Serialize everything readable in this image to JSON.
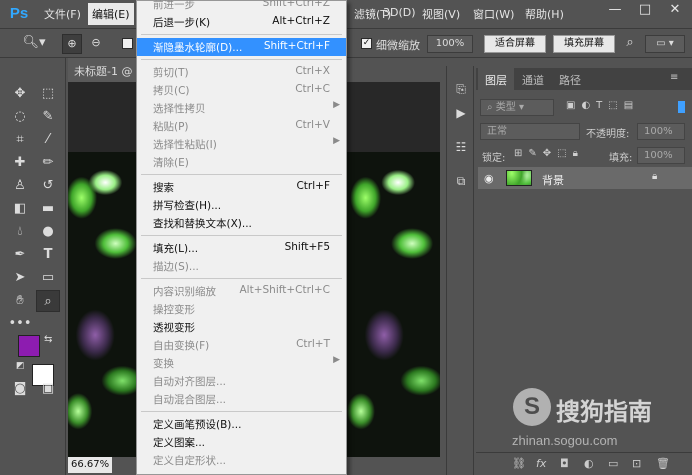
{
  "app": {
    "logo": "Ps",
    "menubar": [
      "文件(F)",
      "编辑(E)",
      "图像(I)",
      "图层(L)",
      "文字(Y)",
      "选择(S)",
      "滤镜(T)",
      "3D(D)",
      "视图(V)",
      "窗口(W)",
      "帮助(H)"
    ],
    "active_menu": "编辑(E)",
    "window_buttons": [
      "—",
      "□",
      "✕"
    ]
  },
  "options_bar": {
    "zoom_chk_label": "细微缩放",
    "zoom_percent": "100%",
    "fit_screen": "适合屏幕",
    "fill_screen": "填充屏幕"
  },
  "document": {
    "tab_title": "未标题-1 @",
    "zoom": "66.67%"
  },
  "edit_menu": {
    "items": [
      {
        "label": "前进一步",
        "shortcut": "Shift+Ctrl+Z",
        "disabled": true,
        "arrow": false
      },
      {
        "label": "后退一步(K)",
        "shortcut": "Alt+Ctrl+Z",
        "disabled": false,
        "arrow": false
      },
      {
        "sep": true
      },
      {
        "label": "渐隐墨水轮廓(D)...",
        "shortcut": "Shift+Ctrl+F",
        "disabled": false,
        "highlighted": true,
        "arrow": false
      },
      {
        "sep": true
      },
      {
        "label": "剪切(T)",
        "shortcut": "Ctrl+X",
        "disabled": true,
        "arrow": false
      },
      {
        "label": "拷贝(C)",
        "shortcut": "Ctrl+C",
        "disabled": true,
        "arrow": false
      },
      {
        "label": "选择性拷贝",
        "shortcut": "",
        "disabled": true,
        "arrow": true
      },
      {
        "label": "粘贴(P)",
        "shortcut": "Ctrl+V",
        "disabled": true,
        "arrow": false
      },
      {
        "label": "选择性粘贴(I)",
        "shortcut": "",
        "disabled": true,
        "arrow": true
      },
      {
        "label": "清除(E)",
        "shortcut": "",
        "disabled": true,
        "arrow": false
      },
      {
        "sep": true
      },
      {
        "label": "搜索",
        "shortcut": "Ctrl+F",
        "disabled": false,
        "arrow": false
      },
      {
        "label": "拼写检查(H)...",
        "shortcut": "",
        "disabled": false,
        "arrow": false
      },
      {
        "label": "查找和替换文本(X)...",
        "shortcut": "",
        "disabled": false,
        "arrow": false
      },
      {
        "sep": true
      },
      {
        "label": "填充(L)...",
        "shortcut": "Shift+F5",
        "disabled": false,
        "arrow": false
      },
      {
        "label": "描边(S)...",
        "shortcut": "",
        "disabled": true,
        "arrow": false
      },
      {
        "sep": true
      },
      {
        "label": "内容识别缩放",
        "shortcut": "Alt+Shift+Ctrl+C",
        "disabled": true,
        "arrow": false
      },
      {
        "label": "操控变形",
        "shortcut": "",
        "disabled": true,
        "arrow": false
      },
      {
        "label": "透视变形",
        "shortcut": "",
        "disabled": false,
        "arrow": false
      },
      {
        "label": "自由变换(F)",
        "shortcut": "Ctrl+T",
        "disabled": true,
        "arrow": false
      },
      {
        "label": "变换",
        "shortcut": "",
        "disabled": true,
        "arrow": true
      },
      {
        "label": "自动对齐图层...",
        "shortcut": "",
        "disabled": true,
        "arrow": false
      },
      {
        "label": "自动混合图层...",
        "shortcut": "",
        "disabled": true,
        "arrow": false
      },
      {
        "sep": true
      },
      {
        "label": "定义画笔预设(B)...",
        "shortcut": "",
        "disabled": false,
        "arrow": false
      },
      {
        "label": "定义图案...",
        "shortcut": "",
        "disabled": false,
        "arrow": false
      },
      {
        "label": "定义自定形状...",
        "shortcut": "",
        "disabled": true,
        "arrow": false
      }
    ]
  },
  "layers_panel": {
    "tabs": [
      "图层",
      "通道",
      "路径"
    ],
    "filter_kind": "类型",
    "blend_mode": "正常",
    "opacity_label": "不透明度:",
    "opacity_value": "100%",
    "lock_label": "锁定:",
    "fill_label": "填充:",
    "fill_value": "100%",
    "layer_name": "背景",
    "bottom_icons": [
      "link",
      "fx",
      "mask",
      "adjustment",
      "group",
      "new-layer",
      "trash"
    ]
  },
  "colors": {
    "foreground": "#8d1cb0",
    "background": "#ffffff",
    "accent": "#3391ff"
  },
  "watermark": {
    "logo": "S",
    "text": "搜狗指南",
    "url": "zhinan.sogou.com"
  }
}
